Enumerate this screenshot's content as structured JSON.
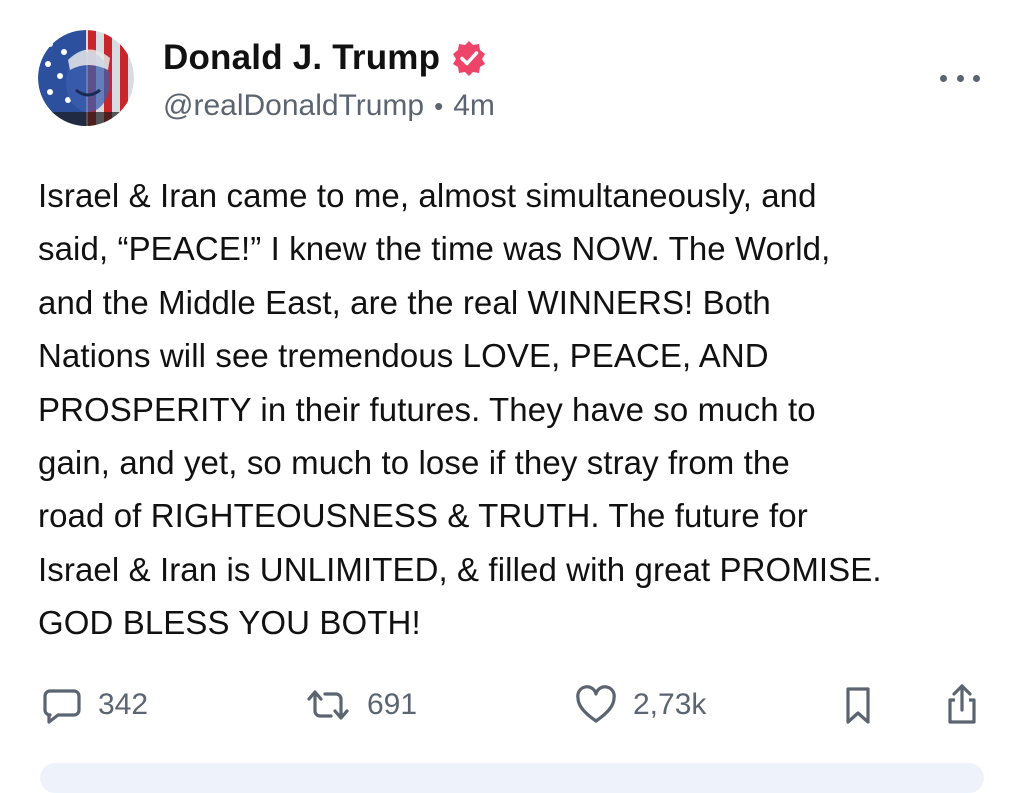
{
  "post": {
    "author": {
      "display_name": "Donald J. Trump",
      "handle": "@realDonaldTrump",
      "separator": "•",
      "time_ago": "4m",
      "verified_icon": "verified-badge-icon",
      "avatar_icon": "avatar"
    },
    "body_lines": [
      "Israel & Iran came to me, almost simultaneously, and",
      "said, “PEACE!” I knew the time was NOW. The World,",
      "and the Middle East, are the real WINNERS! Both",
      "Nations will see tremendous LOVE, PEACE, AND",
      "PROSPERITY in their futures. They have so much to",
      "gain, and yet, so much to lose if they stray from the",
      "road of RIGHTEOUSNESS & TRUTH. The future for",
      "Israel & Iran is UNLIMITED, & filled with great PROMISE.",
      "GOD BLESS YOU BOTH!"
    ],
    "actions": {
      "replies": "342",
      "retruths": "691",
      "likes": "2,73k"
    }
  },
  "colors": {
    "verified_badge": "#ef4469",
    "muted_text": "#5b6470",
    "next_card_bg": "#eef2fb"
  }
}
